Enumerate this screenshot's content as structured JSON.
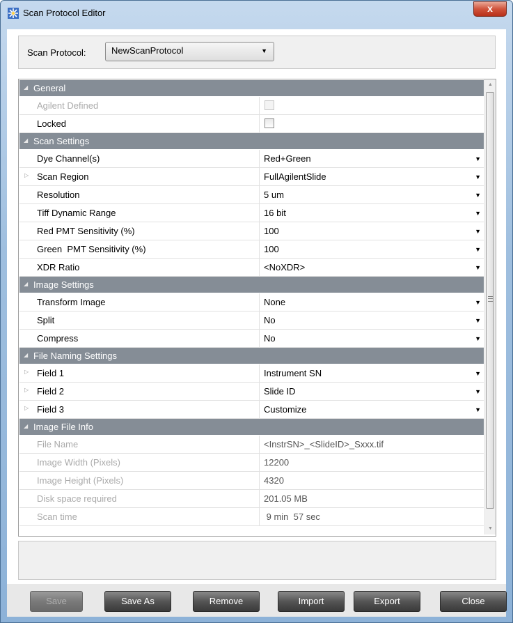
{
  "window": {
    "title": "Scan Protocol Editor",
    "close_label": "x"
  },
  "protocol": {
    "label": "Scan Protocol:",
    "selected": "NewScanProtocol"
  },
  "sections": {
    "general": {
      "title": "General",
      "rows": [
        {
          "label": "Agilent Defined",
          "checked": false,
          "disabled": true
        },
        {
          "label": "Locked",
          "checked": false,
          "disabled": false
        }
      ]
    },
    "scan": {
      "title": "Scan Settings",
      "rows": [
        {
          "label": "Dye Channel(s)",
          "value": "Red+Green",
          "expandable": false
        },
        {
          "label": "Scan Region",
          "value": "FullAgilentSlide",
          "expandable": true
        },
        {
          "label": "Resolution",
          "value": "5 um",
          "expandable": false
        },
        {
          "label": "Tiff Dynamic Range",
          "value": "16 bit",
          "expandable": false
        },
        {
          "label": "Red PMT Sensitivity (%)",
          "value": "100",
          "expandable": false
        },
        {
          "label": "Green  PMT Sensitivity (%)",
          "value": "100",
          "expandable": false
        },
        {
          "label": "XDR Ratio",
          "value": "<NoXDR>",
          "expandable": false
        }
      ]
    },
    "image": {
      "title": "Image Settings",
      "rows": [
        {
          "label": "Transform Image",
          "value": "None"
        },
        {
          "label": "Split",
          "value": "No"
        },
        {
          "label": "Compress",
          "value": "No"
        }
      ]
    },
    "naming": {
      "title": "File Naming Settings",
      "rows": [
        {
          "label": "Field 1",
          "value": "Instrument SN"
        },
        {
          "label": "Field 2",
          "value": "Slide ID"
        },
        {
          "label": "Field 3",
          "value": "Customize"
        }
      ]
    },
    "info": {
      "title": "Image File Info",
      "rows": [
        {
          "label": "File Name",
          "value": "<InstrSN>_<SlideID>_Sxxx.tif"
        },
        {
          "label": "Image Width (Pixels)",
          "value": "12200"
        },
        {
          "label": "Image Height (Pixels)",
          "value": "4320"
        },
        {
          "label": "Disk space required",
          "value": "201.05 MB"
        },
        {
          "label": "Scan time",
          "value": " 9 min  57 sec"
        }
      ]
    }
  },
  "buttons": {
    "save": "Save",
    "save_as": "Save As",
    "remove": "Remove",
    "import": "Import",
    "export": "Export",
    "close": "Close"
  },
  "colors": {
    "section_header": "#858d96",
    "window_frame": "#9fbfdf",
    "close_button": "#c8452e",
    "button_face": "#555555"
  },
  "icons": {
    "app": "scanner-icon",
    "close": "close-icon",
    "dropdown": "dropdown-arrow-icon",
    "collapse": "collapse-triangle-icon",
    "expand": "expand-triangle-icon"
  }
}
